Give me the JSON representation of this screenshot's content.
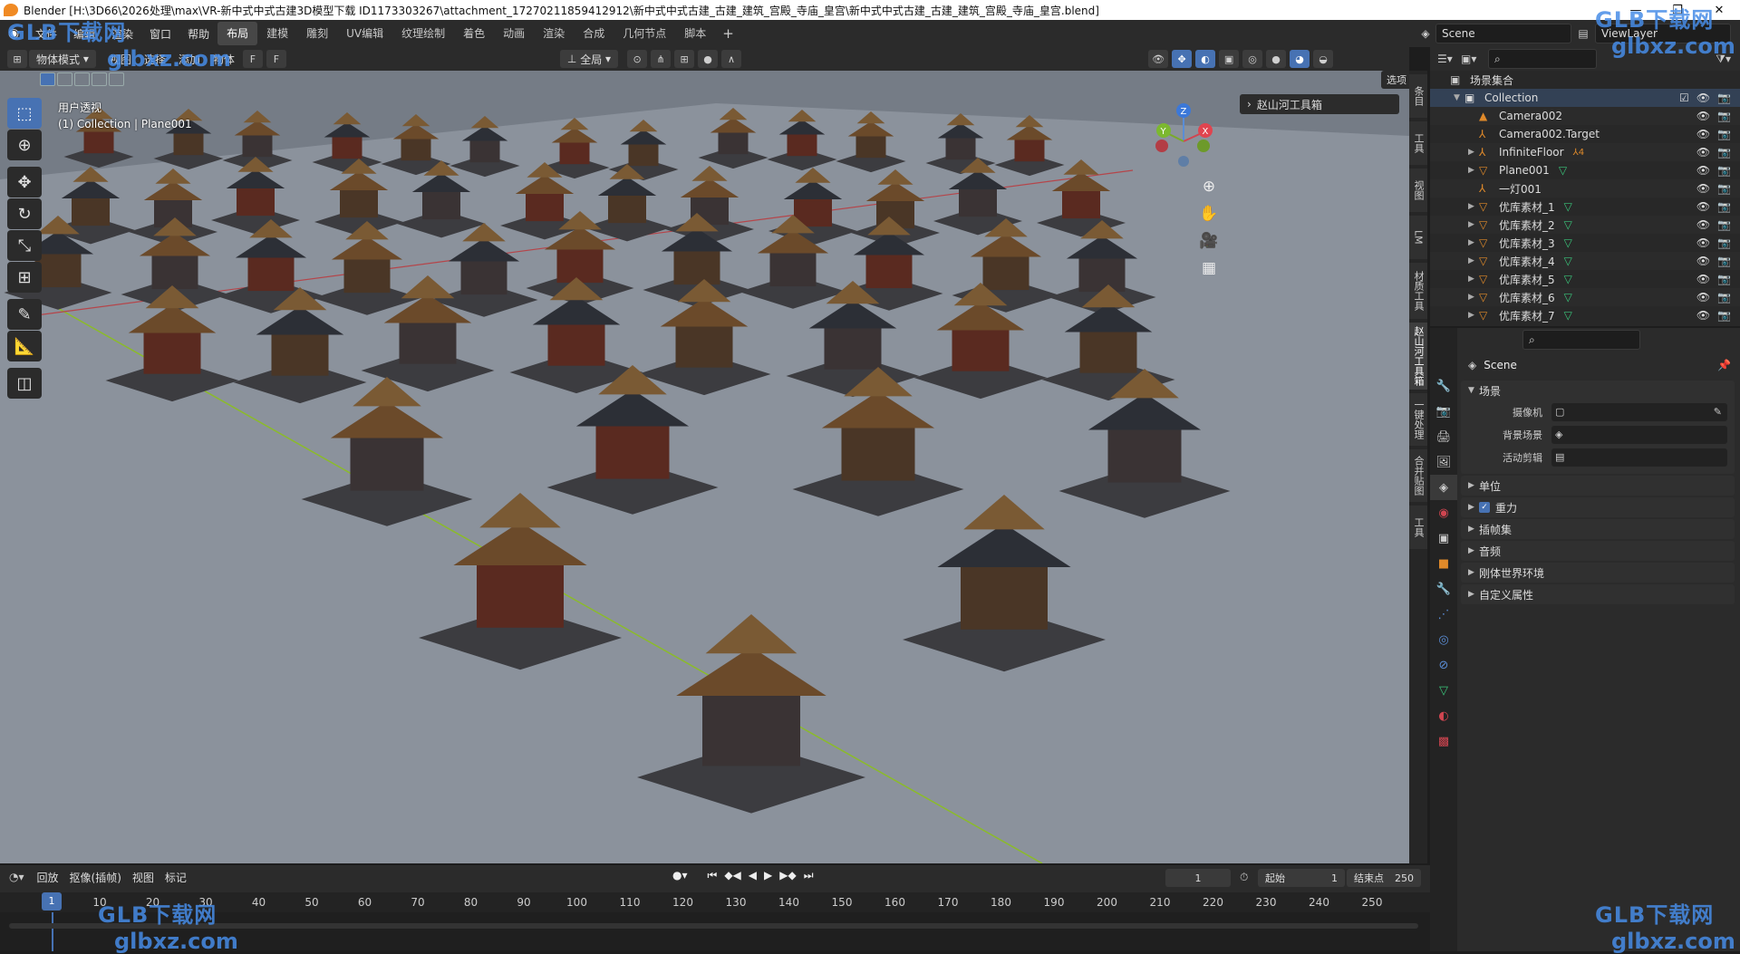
{
  "window": {
    "title": "Blender [H:\\3D66\\2026处理\\max\\VR-新中式中式古建3D模型下载 ID1173303267\\attachment_17270211859412912\\新中式中式古建_古建_建筑_宫殿_寺庙_皇宫\\新中式中式古建_古建_建筑_宫殿_寺庙_皇宫.blend]"
  },
  "menubar": {
    "menus": [
      "文件",
      "编辑",
      "渲染",
      "窗口",
      "帮助"
    ],
    "workspaces": [
      "布局",
      "建模",
      "雕刻",
      "UV编辑",
      "纹理绘制",
      "着色",
      "动画",
      "渲染",
      "合成",
      "几何节点",
      "脚本"
    ],
    "active_workspace": "布局",
    "scene": "Scene",
    "view_layer": "ViewLayer"
  },
  "viewport": {
    "mode": "物体模式",
    "menus": [
      "视图",
      "选择",
      "添加",
      "物体"
    ],
    "transform_orientation": "全局",
    "options_label": "选项",
    "info_line1": "用户透视",
    "info_line2": "(1) Collection | Plane001",
    "toolbox_label": "赵山河工具箱"
  },
  "sidebar_tabs": [
    "条目",
    "工具",
    "视图",
    "LM",
    "材质工具",
    "赵山河工具箱",
    "一键处理",
    "合并贴图",
    "工具"
  ],
  "outliner": {
    "root": "场景集合",
    "collection": "Collection",
    "items": [
      {
        "name": "Camera002",
        "icon": "camera"
      },
      {
        "name": "Camera002.Target",
        "icon": "empty"
      },
      {
        "name": "InfiniteFloor",
        "icon": "empty",
        "extra": "4"
      },
      {
        "name": "Plane001",
        "icon": "mesh"
      },
      {
        "name": "一灯001",
        "icon": "empty"
      },
      {
        "name": "优库素材_1",
        "icon": "mesh"
      },
      {
        "name": "优库素材_2",
        "icon": "mesh"
      },
      {
        "name": "优库素材_3",
        "icon": "mesh"
      },
      {
        "name": "优库素材_4",
        "icon": "mesh"
      },
      {
        "name": "优库素材_5",
        "icon": "mesh"
      },
      {
        "name": "优库素材_6",
        "icon": "mesh"
      },
      {
        "name": "优库素材_7",
        "icon": "mesh"
      }
    ]
  },
  "properties": {
    "context": "Scene",
    "section_scene": "场景",
    "fields": [
      {
        "label": "摄像机",
        "value": ""
      },
      {
        "label": "背景场景",
        "value": ""
      },
      {
        "label": "活动剪辑",
        "value": ""
      }
    ],
    "sections": [
      "单位",
      "重力",
      "插帧集",
      "音频",
      "刚体世界环境",
      "自定义属性"
    ],
    "checked_section": "重力"
  },
  "timeline": {
    "menus": [
      "回放",
      "抠像(插帧)",
      "视图",
      "标记"
    ],
    "current_frame": "1",
    "start_label": "起始",
    "start": "1",
    "end_label": "结束点",
    "end": "250",
    "ticks": [
      "10",
      "20",
      "30",
      "40",
      "50",
      "60",
      "70",
      "80",
      "90",
      "100",
      "110",
      "120",
      "130",
      "140",
      "150",
      "160",
      "170",
      "180",
      "190",
      "200",
      "210",
      "220",
      "230",
      "240",
      "250"
    ]
  },
  "watermark": {
    "brand": "GLB下载网",
    "url": "glbxz.com"
  }
}
